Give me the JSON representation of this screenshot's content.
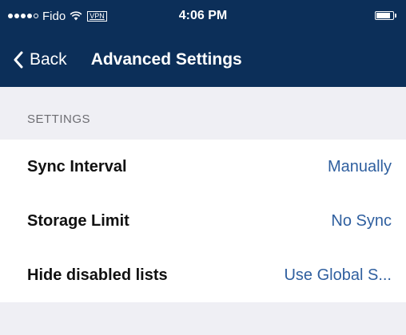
{
  "status_bar": {
    "carrier": "Fido",
    "vpn": "VPN",
    "time": "4:06 PM",
    "battery_level": 0.85,
    "signal_bars": 4,
    "signal_total": 5
  },
  "nav": {
    "back_label": "Back",
    "title": "Advanced Settings"
  },
  "section": {
    "header": "SETTINGS"
  },
  "settings": [
    {
      "label": "Sync Interval",
      "value": "Manually"
    },
    {
      "label": "Storage Limit",
      "value": "No Sync"
    },
    {
      "label": "Hide disabled lists",
      "value": "Use Global S..."
    }
  ],
  "colors": {
    "nav_background": "#0c2f59",
    "page_background": "#efeff4",
    "value_text": "#2f5f9f"
  }
}
